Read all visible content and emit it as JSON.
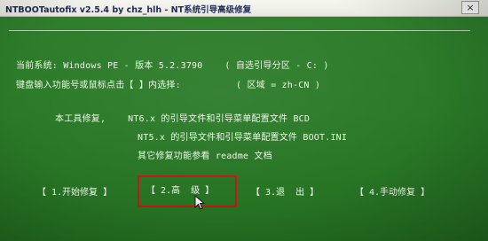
{
  "window": {
    "title": "NTBOOTautofix v2.5.4 by chz_hlh - NT系统引导高级修复",
    "close_label": "×"
  },
  "info": {
    "system_line": "当前系统: Windows PE - 版本 5.2.3790    ( 自选引导分区 - C: )",
    "prompt_line": "键盘输入功能号或鼠标点击【 】内选择:          ( 区域 = zh-CN )"
  },
  "repair": {
    "line1": "本工具修复,    NT6.x 的引导文件和引导菜单配置文件 BCD",
    "line2": "NT5.x 的引导文件和引导菜单配置文件 BOOT.INI",
    "line3": "其它修复功能参看 readme 文档"
  },
  "menu": {
    "items": [
      {
        "label": "【 1.开始修复 】"
      },
      {
        "label": "【 2.高  级 】"
      },
      {
        "label": "【 3.退  出 】"
      },
      {
        "label": "【 4.手动修复 】"
      }
    ],
    "selected_index": 1,
    "highlight_color": "#c61414"
  },
  "colors": {
    "background": "#2a7a28",
    "text": "#eef6e6"
  },
  "icons": {
    "cursor": "mouse-pointer-icon"
  }
}
